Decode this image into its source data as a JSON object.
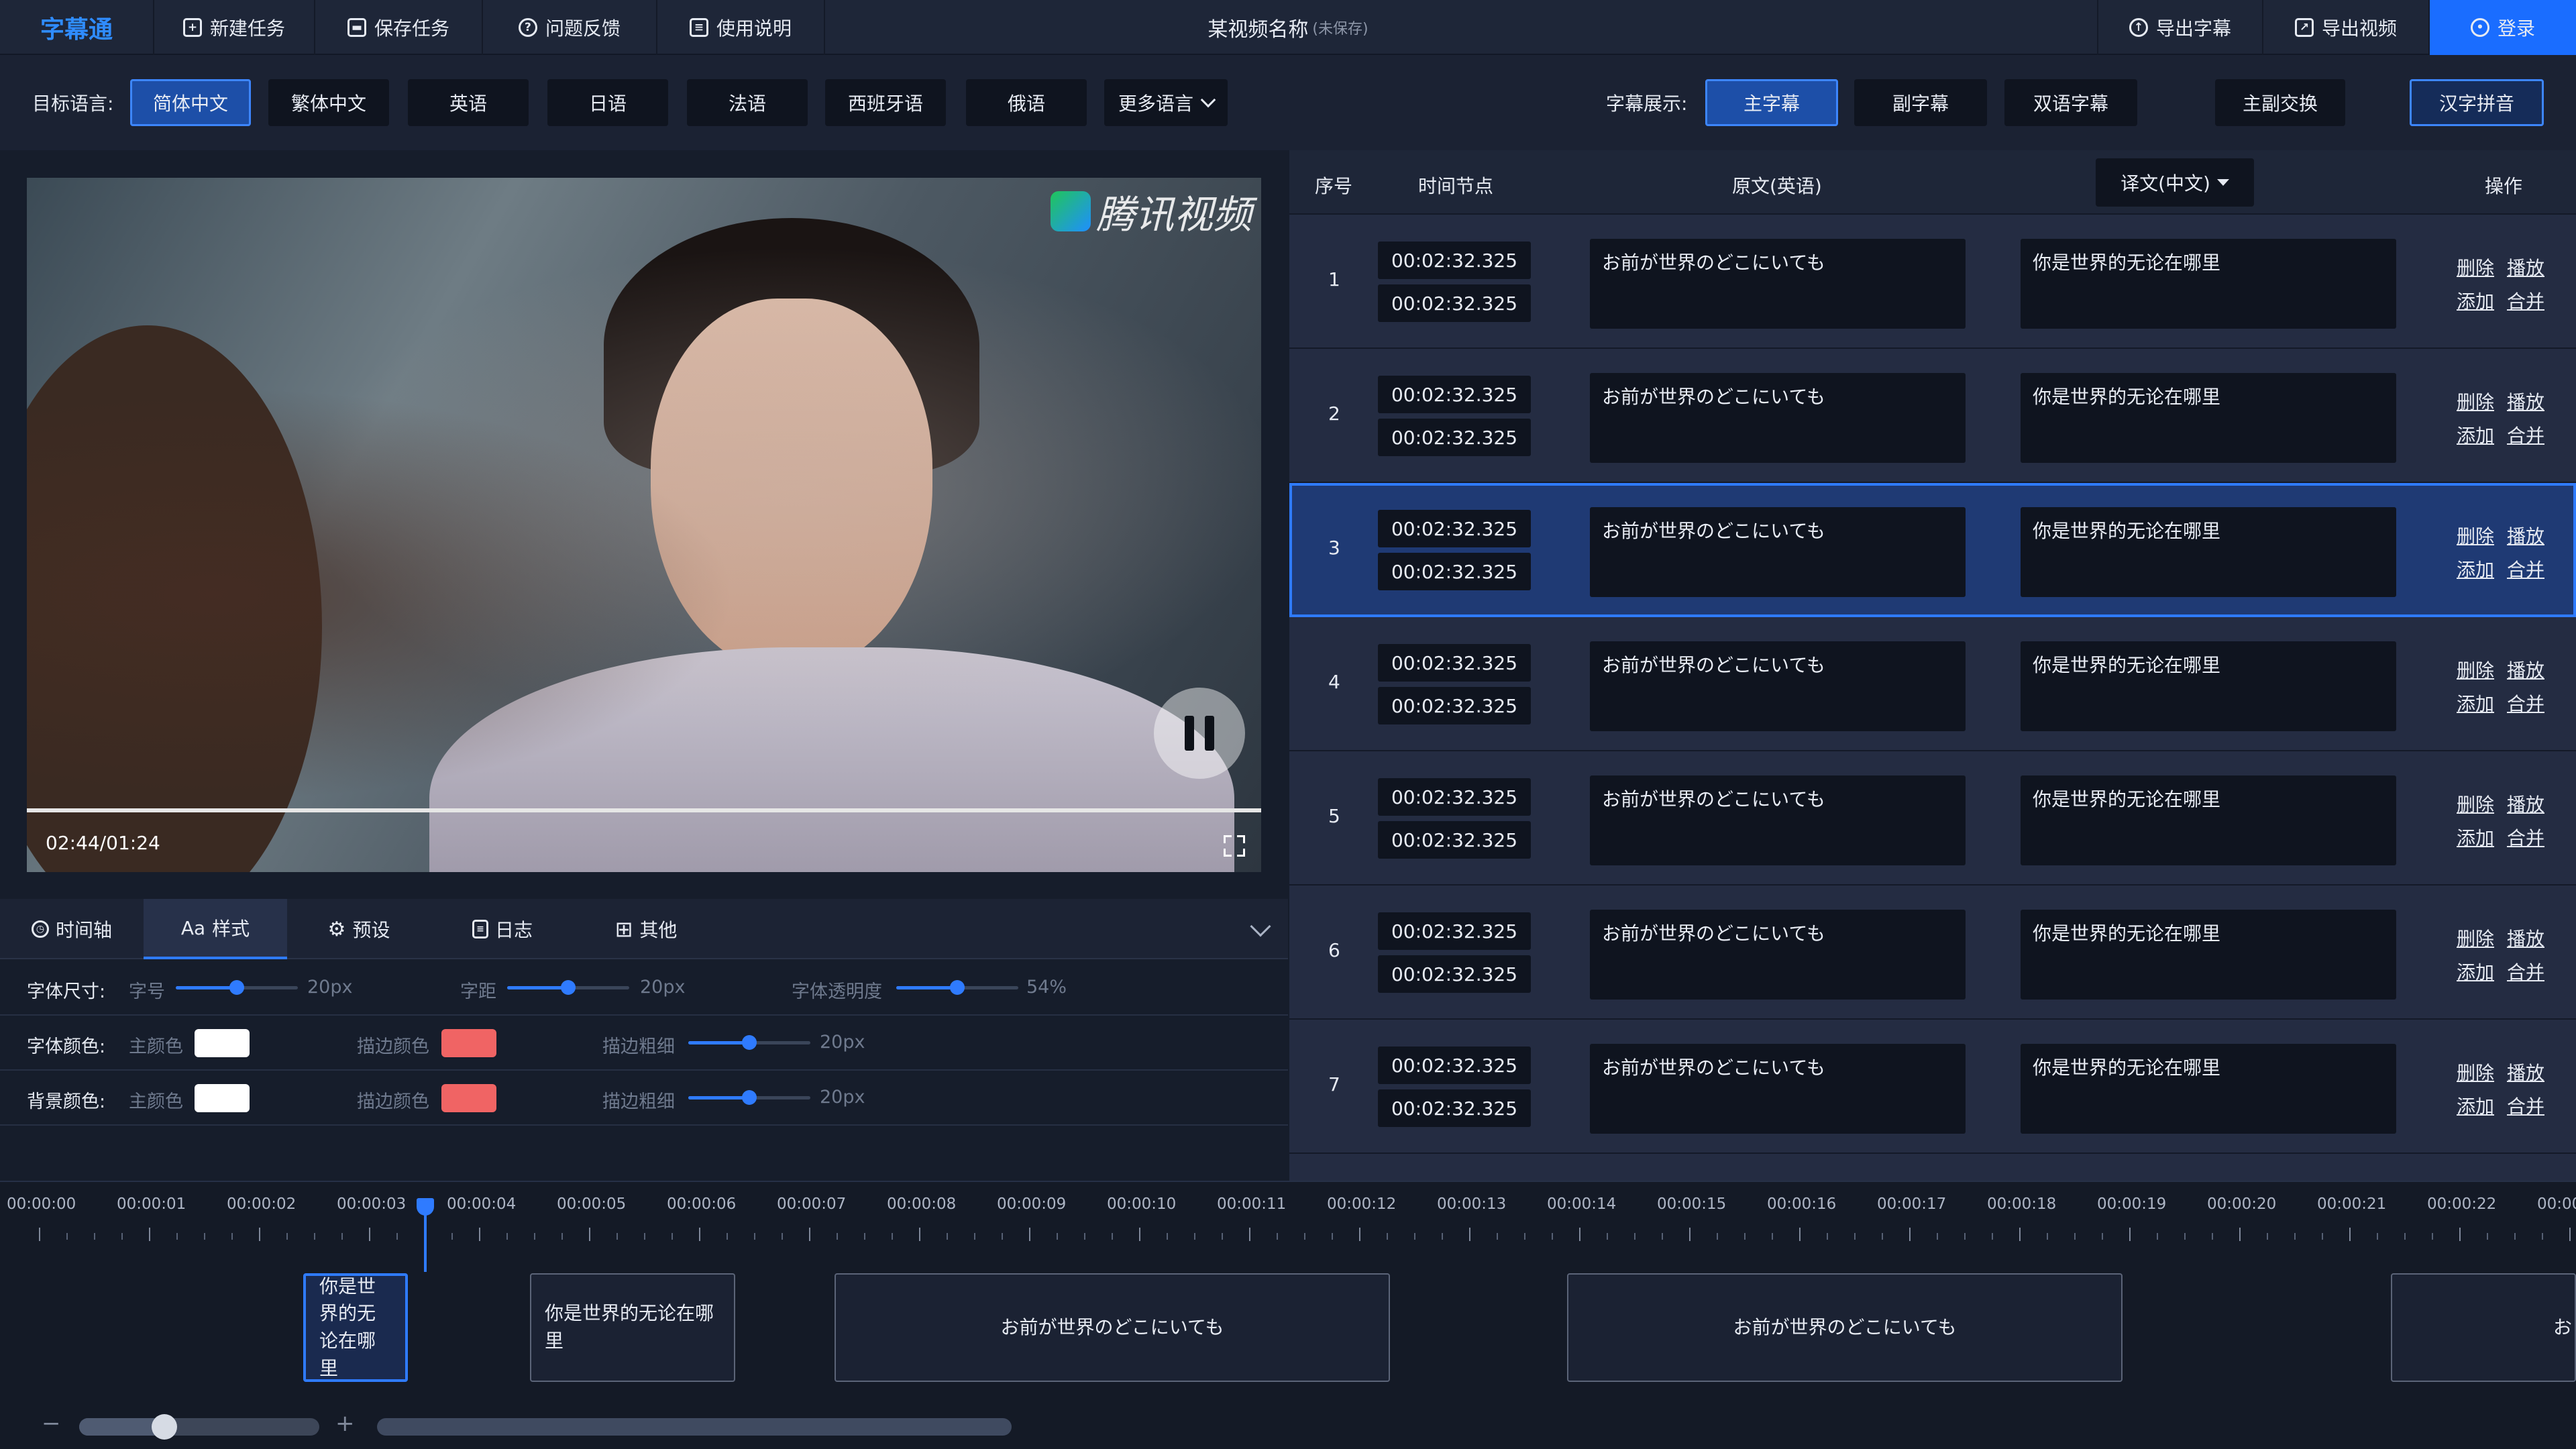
{
  "app": {
    "logo": "字幕通"
  },
  "toolbar": {
    "new_task": "新建任务",
    "save_task": "保存任务",
    "feedback": "问题反馈",
    "help": "使用说明",
    "export_subtitle": "导出字幕",
    "export_video": "导出视频",
    "login": "登录"
  },
  "document": {
    "title": "某视频名称",
    "status": "(未保存)"
  },
  "languages": {
    "label": "目标语言:",
    "items": [
      "简体中文",
      "繁体中文",
      "英语",
      "日语",
      "法语",
      "西班牙语",
      "俄语"
    ],
    "selected": "简体中文",
    "more": "更多语言"
  },
  "display": {
    "label": "字幕展示:",
    "modes": [
      "主字幕",
      "副字幕",
      "双语字幕"
    ],
    "selected": "主字幕",
    "swap": "主副交换",
    "pinyin": "汉字拼音"
  },
  "video": {
    "watermark": "腾讯视频",
    "time": "02:44/01:24",
    "progress": 1.0
  },
  "tabs": {
    "items": [
      "时间轴",
      "样式",
      "预设",
      "日志",
      "其他"
    ],
    "active": "样式"
  },
  "style": {
    "font_size": {
      "label": "字体尺寸:",
      "size_label": "字号",
      "size_value": "20px",
      "size_pos": 0.5,
      "spacing_label": "字距",
      "spacing_value": "20px",
      "spacing_pos": 0.5,
      "opacity_label": "字体透明度",
      "opacity_value": "54%",
      "opacity_pos": 0.5
    },
    "font_color": {
      "label": "字体颜色:",
      "main_label": "主颜色",
      "main_color": "#ffffff",
      "stroke_label": "描边颜色",
      "stroke_color": "#f06464",
      "width_label": "描边粗细",
      "width_value": "20px",
      "width_pos": 0.5
    },
    "bg_color": {
      "label": "背景颜色:",
      "main_label": "主颜色",
      "main_color": "#ffffff",
      "stroke_label": "描边颜色",
      "stroke_color": "#f06464",
      "width_label": "描边粗细",
      "width_value": "20px",
      "width_pos": 0.5
    }
  },
  "table": {
    "headers": {
      "index": "序号",
      "time": "时间节点",
      "source": "原文(英语)",
      "target": "译文(中文)",
      "actions": "操作"
    },
    "action_labels": {
      "delete": "删除",
      "play": "播放",
      "add": "添加",
      "merge": "合并"
    },
    "selected_row": 3,
    "rows": [
      {
        "index": "1",
        "start": "00:02:32.325",
        "end": "00:02:32.325",
        "source": "お前が世界のどこにいても",
        "target": "你是世界的无论在哪里"
      },
      {
        "index": "2",
        "start": "00:02:32.325",
        "end": "00:02:32.325",
        "source": "お前が世界のどこにいても",
        "target": "你是世界的无论在哪里"
      },
      {
        "index": "3",
        "start": "00:02:32.325",
        "end": "00:02:32.325",
        "source": "お前が世界のどこにいても",
        "target": "你是世界的无论在哪里"
      },
      {
        "index": "4",
        "start": "00:02:32.325",
        "end": "00:02:32.325",
        "source": "お前が世界のどこにいても",
        "target": "你是世界的无论在哪里"
      },
      {
        "index": "5",
        "start": "00:02:32.325",
        "end": "00:02:32.325",
        "source": "お前が世界のどこにいても",
        "target": "你是世界的无论在哪里"
      },
      {
        "index": "6",
        "start": "00:02:32.325",
        "end": "00:02:32.325",
        "source": "お前が世界のどこにいても",
        "target": "你是世界的无论在哪里"
      },
      {
        "index": "7",
        "start": "00:02:32.325",
        "end": "00:02:32.325",
        "source": "お前が世界のどこにいても",
        "target": "你是世界的无论在哪里"
      }
    ]
  },
  "timeline": {
    "ticks": [
      "00:00:00",
      "00:00:01",
      "00:00:02",
      "00:00:03",
      "00:00:04",
      "00:00:05",
      "00:00:06",
      "00:00:07",
      "00:00:08",
      "00:00:09",
      "00:00:10",
      "00:00:11",
      "00:00:12",
      "00:00:13",
      "00:00:14",
      "00:00:15",
      "00:00:16",
      "00:00:17",
      "00:00:18",
      "00:00:19",
      "00:00:20",
      "00:00:21",
      "00:00:22",
      "00:00"
    ],
    "clips": [
      {
        "text": "你是世界的无论在哪里",
        "selected": true
      },
      {
        "text": "你是世界的无论在哪里",
        "selected": false
      },
      {
        "text": "お前が世界のどこにいても",
        "selected": false
      },
      {
        "text": "お前が世界のどこにいても",
        "selected": false
      },
      {
        "text": "お",
        "selected": false
      }
    ],
    "zoom_minus": "−",
    "zoom_plus": "+"
  },
  "colors": {
    "accent": "#2f7bff",
    "logo": "#2f8cff",
    "login_bg": "#1a6dff"
  }
}
